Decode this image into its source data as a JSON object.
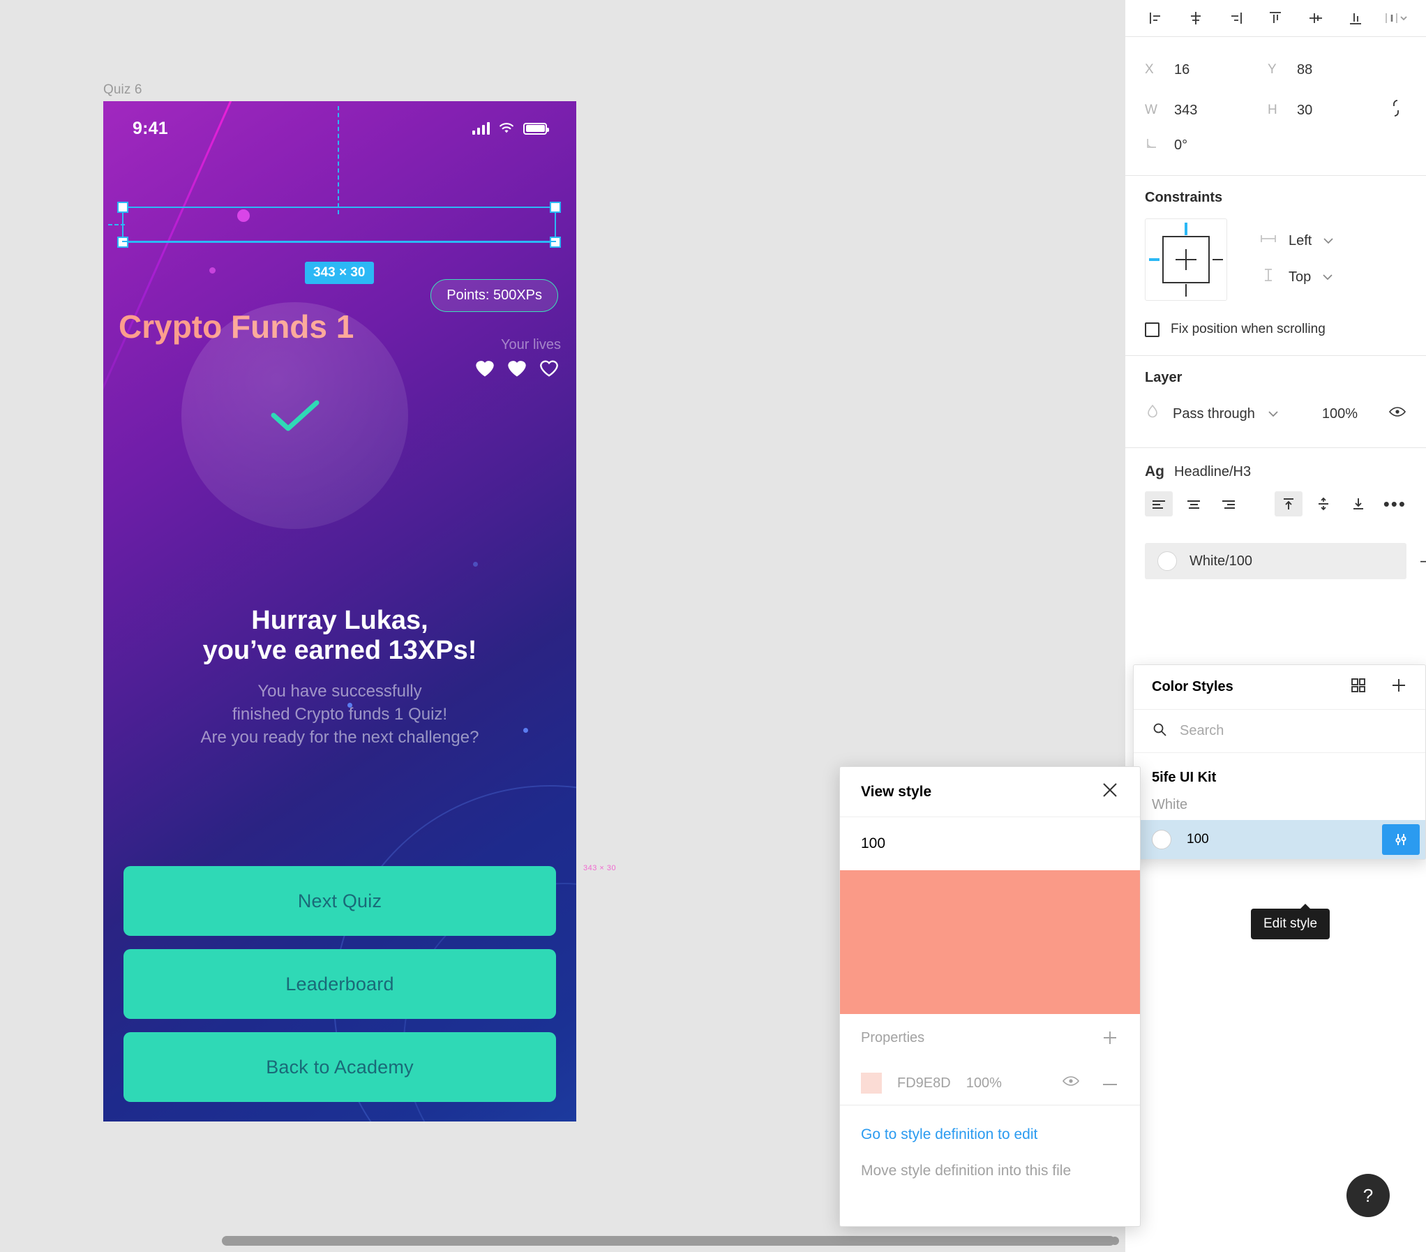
{
  "canvas": {
    "frame_label": "Quiz 6"
  },
  "phone": {
    "status": {
      "time": "9:41"
    },
    "points_pill": "Points: 500XPs",
    "title": "Crypto Funds 1",
    "lives_label": "Your lives",
    "headline_line1": "Hurray Lukas,",
    "headline_line2": "you’ve earned 13XPs!",
    "sub_line1": "You have successfully",
    "sub_line2": "finished Crypto funds 1 Quiz!",
    "sub_line3": "Are you ready for the next challenge?",
    "buttons": [
      {
        "label": "Next Quiz"
      },
      {
        "label": "Leaderboard"
      },
      {
        "label": "Back to Academy"
      }
    ],
    "colors": {
      "title": "#FD9E8D",
      "cta": "#2FD9B6",
      "cta_text": "#1A6A78",
      "accent_teal": "#3EE0B8",
      "gradient_top": "#A128BF",
      "gradient_bottom": "#1C3A9E"
    }
  },
  "selection": {
    "dimension_badge": "343 × 30",
    "handle_color": "#2CB8F5",
    "measure_note": "343 × 30"
  },
  "inspector": {
    "align_icons": [
      "align-left-icon",
      "align-horizontal-center-icon",
      "align-right-icon",
      "align-top-icon",
      "align-vertical-center-icon",
      "align-bottom-icon",
      "distribute-icon"
    ],
    "geometry": {
      "x_key": "X",
      "x_value": "16",
      "y_key": "Y",
      "y_value": "88",
      "w_key": "W",
      "w_value": "343",
      "h_key": "H",
      "h_value": "30",
      "rotation_value": "0°"
    },
    "constraints": {
      "title": "Constraints",
      "horizontal": "Left",
      "vertical": "Top",
      "fix_position_label": "Fix position when scrolling",
      "fix_position_checked": false
    },
    "layer": {
      "title": "Layer",
      "blend_mode": "Pass through",
      "opacity": "100%"
    },
    "typography": {
      "ag_label": "Ag",
      "style_name": "Headline/H3",
      "align_horizontal_active": "left",
      "align_vertical_active": "top"
    },
    "fill": {
      "style_name": "White/100"
    }
  },
  "color_styles_popover": {
    "title": "Color Styles",
    "search_placeholder": "Search",
    "group_name": "5ife UI Kit",
    "subgroup_name": "White",
    "items": [
      {
        "label": "100",
        "selected": true
      }
    ],
    "tooltip": "Edit style"
  },
  "view_style_dialog": {
    "title": "View style",
    "style_name": "100",
    "swatch_hex": "#FA9A87",
    "properties_label": "Properties",
    "property": {
      "hex": "FD9E8D",
      "opacity": "100%"
    },
    "go_to_definition": "Go to style definition to edit",
    "move_definition": "Move style definition into this file"
  },
  "help": {
    "glyph": "?"
  }
}
